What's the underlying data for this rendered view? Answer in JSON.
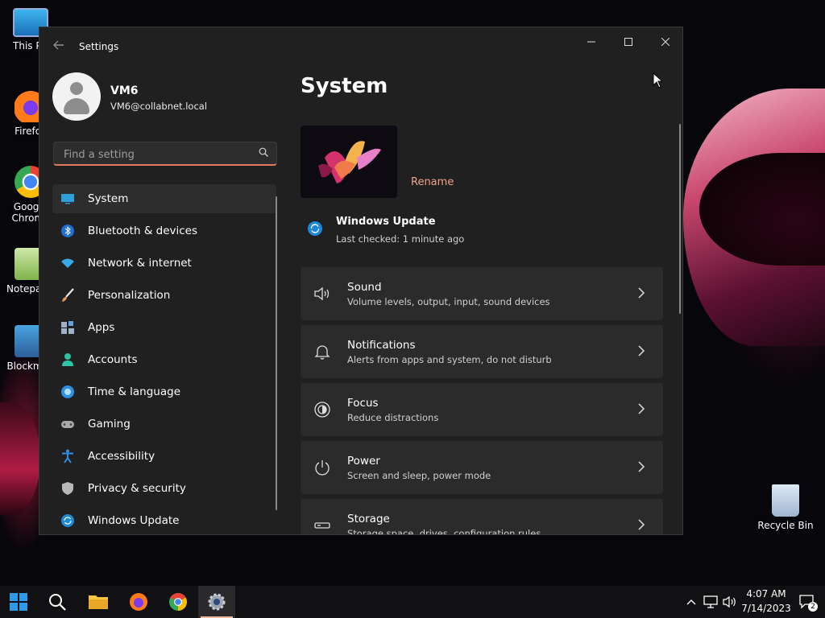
{
  "desktop": {
    "icons": [
      {
        "label": "This PC"
      },
      {
        "label": "Firefox"
      },
      {
        "label": "Google Chrome"
      },
      {
        "label": "Notepad++"
      },
      {
        "label": "Blockman"
      },
      {
        "label": "Recycle Bin"
      }
    ]
  },
  "window": {
    "title": "Settings",
    "controls": {
      "minimize": "—",
      "maximize": "☐",
      "close": "✕"
    }
  },
  "profile": {
    "name": "VM6",
    "email": "VM6@collabnet.local"
  },
  "search": {
    "placeholder": "Find a setting",
    "value": ""
  },
  "nav": {
    "items": [
      {
        "label": "System",
        "icon": "monitor-icon",
        "active": true
      },
      {
        "label": "Bluetooth & devices",
        "icon": "bluetooth-icon"
      },
      {
        "label": "Network & internet",
        "icon": "wifi-icon"
      },
      {
        "label": "Personalization",
        "icon": "brush-icon"
      },
      {
        "label": "Apps",
        "icon": "apps-icon"
      },
      {
        "label": "Accounts",
        "icon": "account-icon"
      },
      {
        "label": "Time & language",
        "icon": "globe-clock-icon"
      },
      {
        "label": "Gaming",
        "icon": "gamepad-icon"
      },
      {
        "label": "Accessibility",
        "icon": "accessibility-icon"
      },
      {
        "label": "Privacy & security",
        "icon": "shield-icon"
      },
      {
        "label": "Windows Update",
        "icon": "update-icon"
      }
    ]
  },
  "main": {
    "title": "System",
    "rename_label": "Rename",
    "windows_update": {
      "title": "Windows Update",
      "status": "Last checked: 1 minute ago"
    },
    "cards": [
      {
        "title": "Sound",
        "subtitle": "Volume levels, output, input, sound devices",
        "icon": "speaker-icon"
      },
      {
        "title": "Notifications",
        "subtitle": "Alerts from apps and system, do not disturb",
        "icon": "bell-icon"
      },
      {
        "title": "Focus",
        "subtitle": "Reduce distractions",
        "icon": "focus-icon"
      },
      {
        "title": "Power",
        "subtitle": "Screen and sleep, power mode",
        "icon": "power-icon"
      },
      {
        "title": "Storage",
        "subtitle": "Storage space, drives, configuration rules",
        "icon": "storage-icon"
      }
    ]
  },
  "taskbar": {
    "apps": [
      "start",
      "search",
      "file-explorer",
      "firefox",
      "chrome",
      "settings"
    ],
    "active": "settings",
    "clock": {
      "time": "4:07 AM",
      "date": "7/14/2023"
    },
    "notification_count": "2"
  },
  "colors": {
    "accent": "#f0a28a",
    "window_bg": "#202020",
    "card_bg": "#2b2b2b"
  }
}
